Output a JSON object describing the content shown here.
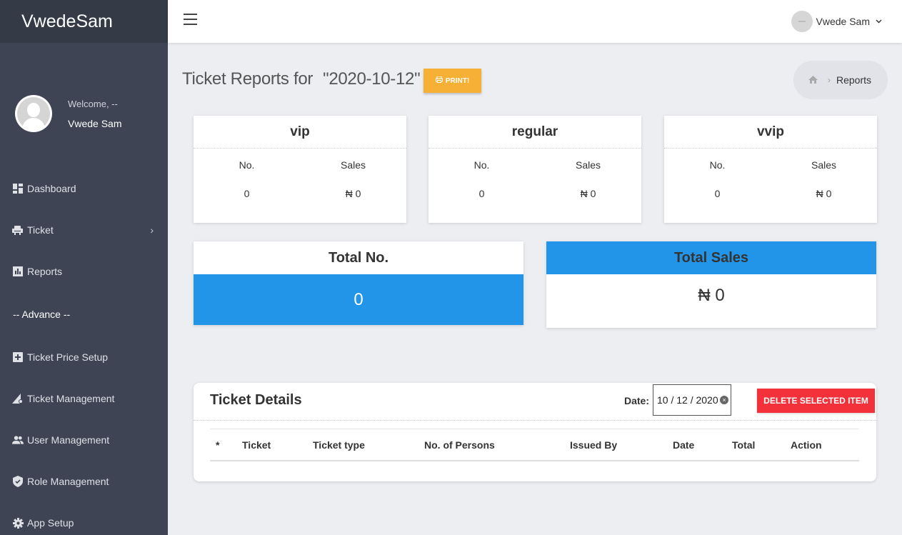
{
  "brand": "VwedeSam",
  "profile": {
    "welcome": "Welcome, --",
    "name": "Vwede Sam"
  },
  "nav": {
    "dashboard": "Dashboard",
    "ticket": "Ticket",
    "reports": "Reports",
    "section": "-- Advance --",
    "price_setup": "Ticket Price Setup",
    "ticket_mgmt": "Ticket Management",
    "user_mgmt": "User Management",
    "role_mgmt": "Role Management",
    "app_setup": "App Setup"
  },
  "topbar": {
    "user": "Vwede Sam"
  },
  "header": {
    "title": "Ticket Reports for",
    "date": "\"2020-10-12\"",
    "print_label": "PRINT!"
  },
  "breadcrumb": {
    "current": "Reports"
  },
  "type_cards": [
    {
      "title": "vip",
      "no_label": "No.",
      "sales_label": "Sales",
      "no": "0",
      "sales": "₦ 0"
    },
    {
      "title": "regular",
      "no_label": "No.",
      "sales_label": "Sales",
      "no": "0",
      "sales": "₦ 0"
    },
    {
      "title": "vvip",
      "no_label": "No.",
      "sales_label": "Sales",
      "no": "0",
      "sales": "₦ 0"
    }
  ],
  "totals": {
    "no_title": "Total No.",
    "no_value": "0",
    "sales_title": "Total Sales",
    "sales_value": "₦ 0"
  },
  "details": {
    "title": "Ticket Details",
    "date_label": "Date:",
    "date_value": "10 / 12 / 2020",
    "delete_label": "DELETE SELECTED ITEM",
    "columns": [
      "*",
      "Ticket",
      "Ticket type",
      "No. of Persons",
      "Issued By",
      "Date",
      "Total",
      "Action"
    ]
  },
  "colors": {
    "sidebar": "#3e4454",
    "accent_blue": "#2395e8",
    "print": "#f6b036",
    "danger": "#f2313a"
  }
}
